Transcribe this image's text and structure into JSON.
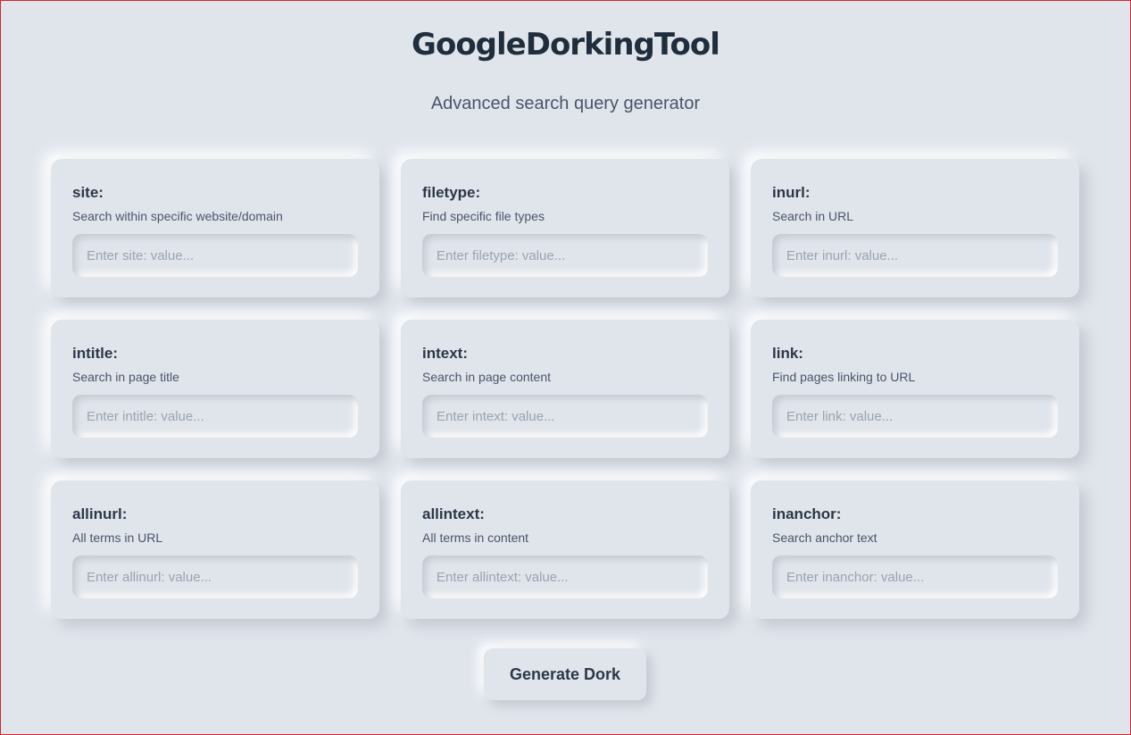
{
  "header": {
    "title": "GoogleDorkingTool",
    "subtitle": "Advanced search query generator"
  },
  "operators": [
    {
      "label": "site:",
      "description": "Search within specific website/domain",
      "placeholder": "Enter site: value...",
      "value": ""
    },
    {
      "label": "filetype:",
      "description": "Find specific file types",
      "placeholder": "Enter filetype: value...",
      "value": ""
    },
    {
      "label": "inurl:",
      "description": "Search in URL",
      "placeholder": "Enter inurl: value...",
      "value": ""
    },
    {
      "label": "intitle:",
      "description": "Search in page title",
      "placeholder": "Enter intitle: value...",
      "value": ""
    },
    {
      "label": "intext:",
      "description": "Search in page content",
      "placeholder": "Enter intext: value...",
      "value": ""
    },
    {
      "label": "link:",
      "description": "Find pages linking to URL",
      "placeholder": "Enter link: value...",
      "value": ""
    },
    {
      "label": "allinurl:",
      "description": "All terms in URL",
      "placeholder": "Enter allinurl: value...",
      "value": ""
    },
    {
      "label": "allintext:",
      "description": "All terms in content",
      "placeholder": "Enter allintext: value...",
      "value": ""
    },
    {
      "label": "inanchor:",
      "description": "Search anchor text",
      "placeholder": "Enter inanchor: value...",
      "value": ""
    }
  ],
  "actions": {
    "generate_label": "Generate Dork"
  },
  "colors": {
    "background": "#e0e5ec",
    "text_primary": "#2d3748",
    "text_secondary": "#4a5568",
    "placeholder": "#9aa3b0",
    "frame_border": "#d9262b"
  }
}
